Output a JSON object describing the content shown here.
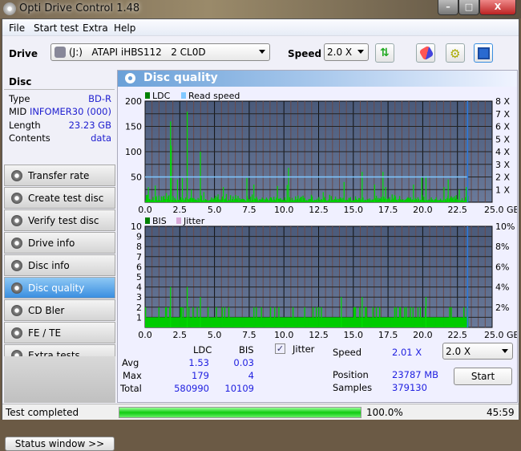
{
  "window": {
    "title": "Opti Drive Control 1.48",
    "min": "–",
    "max": "□",
    "close": "X"
  },
  "menu": [
    "File",
    "Start test",
    "Extra",
    "Help"
  ],
  "toolbar": {
    "drive_label": "Drive",
    "drive_value": "(J:)   ATAPI iHBS112   2 CL0D",
    "speed_label": "Speed",
    "speed_value": "2.0 X"
  },
  "sidebar": {
    "header": "Disc",
    "info": [
      {
        "k": "Type",
        "v": "BD-R"
      },
      {
        "k": "MID",
        "v": "INFOMER30 (000)"
      },
      {
        "k": "Length",
        "v": "23.23 GB"
      },
      {
        "k": "Contents",
        "v": "data"
      }
    ],
    "items": [
      "Transfer rate",
      "Create test disc",
      "Verify test disc",
      "Drive info",
      "Disc info",
      "Disc quality",
      "CD Bler",
      "FE / TE",
      "Extra tests"
    ],
    "active": "Disc quality",
    "status_button": "Status window >>"
  },
  "panel": {
    "title": "Disc quality"
  },
  "chart_data": [
    {
      "type": "bar",
      "legend": [
        "LDC",
        "Read speed"
      ],
      "colors": {
        "LDC": "#00cc00",
        "Read speed": "#80c8ff"
      },
      "x_ticks": [
        "0.0",
        "2.5",
        "5.0",
        "7.5",
        "10.0",
        "12.5",
        "15.0",
        "17.5",
        "20.0",
        "22.5",
        "25.0 GB"
      ],
      "y_ticks": [
        "200",
        "150",
        "100",
        "50"
      ],
      "y2_ticks": [
        "8 X",
        "7 X",
        "6 X",
        "5 X",
        "4 X",
        "3 X",
        "2 X",
        "1 X"
      ],
      "xlim": [
        0,
        25
      ],
      "ylim": [
        0,
        200
      ],
      "y2lim": [
        0,
        8
      ],
      "read_speed": 2.0,
      "end_position": 23.23,
      "peaks": [
        [
          0.2,
          30
        ],
        [
          0.7,
          33
        ],
        [
          1.5,
          18
        ],
        [
          1.8,
          160
        ],
        [
          1.85,
          112
        ],
        [
          2.3,
          45
        ],
        [
          2.65,
          48
        ],
        [
          3.0,
          179
        ],
        [
          3.3,
          25
        ],
        [
          3.95,
          100
        ],
        [
          4.2,
          20
        ],
        [
          5.6,
          30
        ],
        [
          7.3,
          48
        ],
        [
          7.8,
          35
        ],
        [
          9.5,
          32
        ],
        [
          10.3,
          68
        ],
        [
          10.2,
          34
        ],
        [
          12.8,
          20
        ],
        [
          14.3,
          40
        ],
        [
          15.6,
          60
        ],
        [
          16.5,
          35
        ],
        [
          17.1,
          60
        ],
        [
          17.3,
          30
        ],
        [
          19.3,
          35
        ],
        [
          19.9,
          50
        ],
        [
          20.2,
          52
        ],
        [
          21.5,
          30
        ],
        [
          21.8,
          45
        ],
        [
          22.6,
          25
        ],
        [
          23.1,
          30
        ]
      ]
    },
    {
      "type": "bar",
      "legend": [
        "BIS",
        "Jitter"
      ],
      "colors": {
        "BIS": "#00cc00",
        "Jitter": "#d8a8d8"
      },
      "x_ticks": [
        "0.0",
        "2.5",
        "5.0",
        "7.5",
        "10.0",
        "12.5",
        "15.0",
        "17.5",
        "20.0",
        "22.5",
        "25.0 GB"
      ],
      "y_ticks": [
        "10",
        "9",
        "8",
        "7",
        "6",
        "5",
        "4",
        "3",
        "2",
        "1"
      ],
      "y2_ticks": [
        "10%",
        "8%",
        "6%",
        "4%",
        "2%"
      ],
      "xlim": [
        0,
        25
      ],
      "ylim": [
        0,
        10
      ],
      "end_position": 23.23,
      "peaks": [
        [
          1.8,
          4
        ],
        [
          3.0,
          4
        ],
        [
          3.95,
          3
        ],
        [
          14.1,
          3
        ],
        [
          15.6,
          3
        ],
        [
          20.2,
          3
        ]
      ]
    }
  ],
  "stats": {
    "col_ldc": "LDC",
    "col_bis": "BIS",
    "rows": [
      {
        "k": "Avg",
        "ldc": "1.53",
        "bis": "0.03"
      },
      {
        "k": "Max",
        "ldc": "179",
        "bis": "4"
      },
      {
        "k": "Total",
        "ldc": "580990",
        "bis": "10109"
      }
    ],
    "jitter_label": "Jitter",
    "jitter_checked": true,
    "speed_label": "Speed",
    "speed_value": "2.01 X",
    "position_label": "Position",
    "position_value": "23787 MB",
    "samples_label": "Samples",
    "samples_value": "379130",
    "speed_select": "2.0 X",
    "start": "Start"
  },
  "status": {
    "text": "Test completed",
    "progress": 100.0,
    "progress_text": "100.0%",
    "time": "45:59"
  }
}
